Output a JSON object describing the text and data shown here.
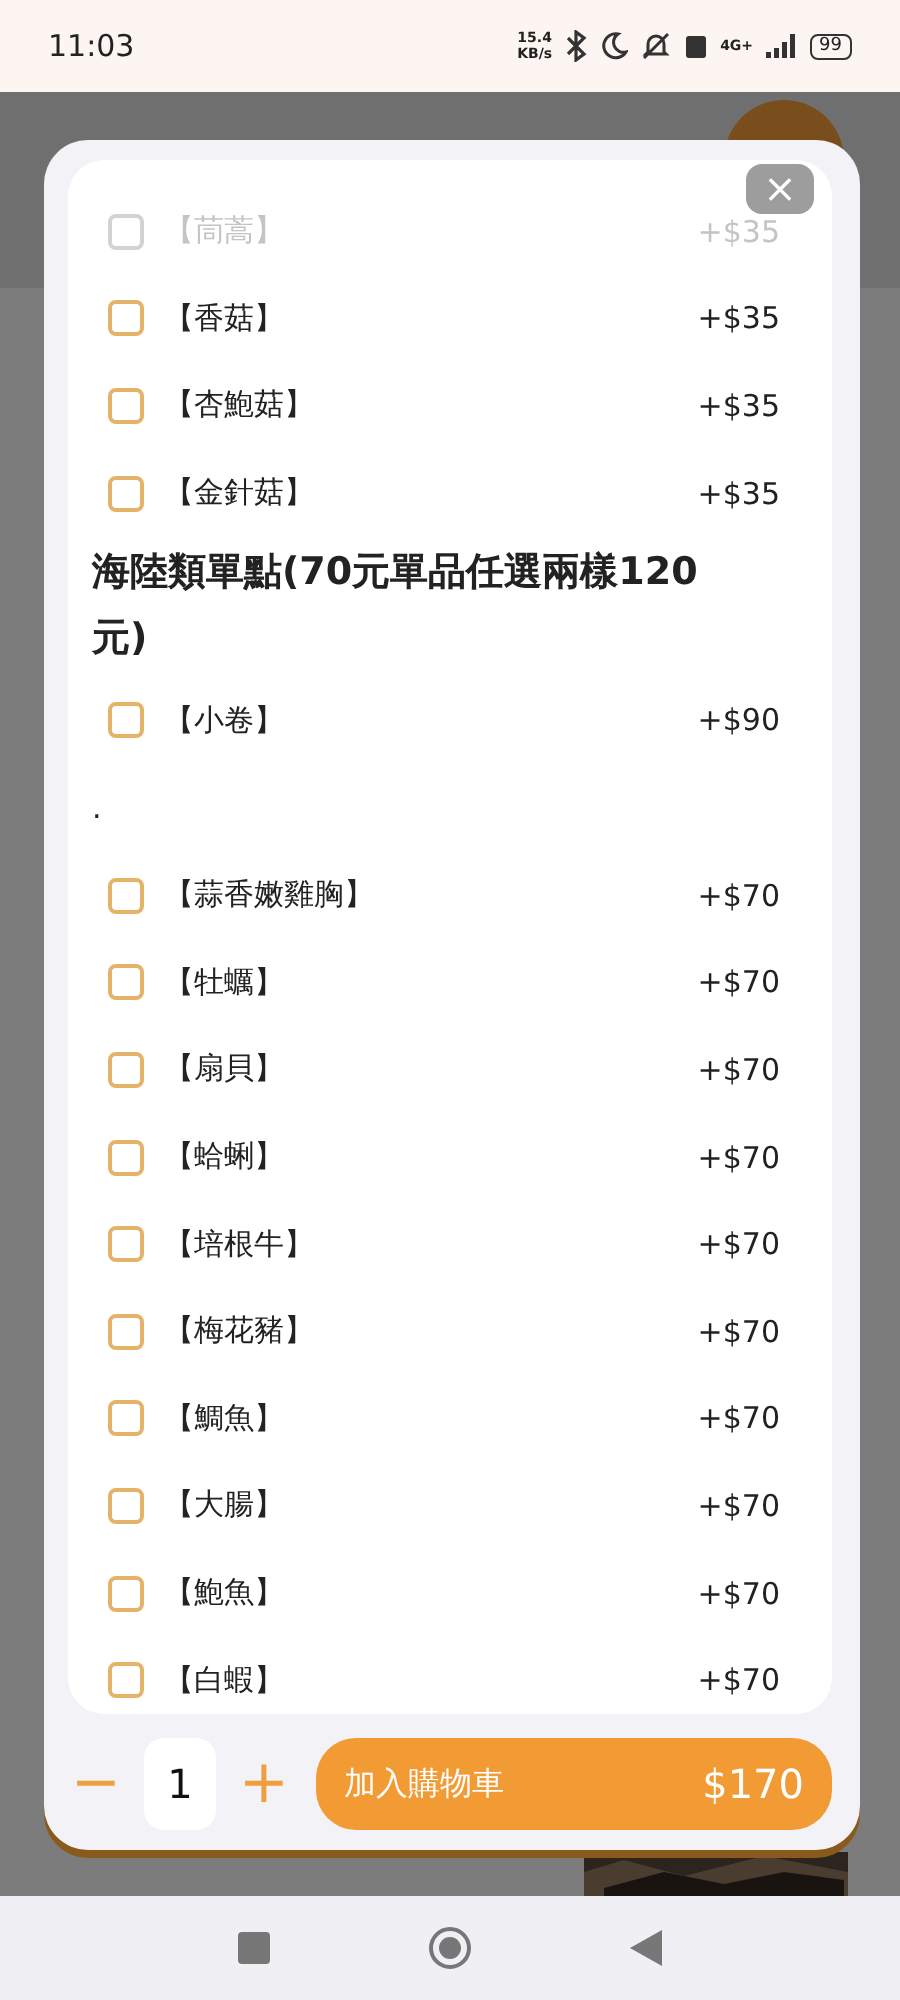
{
  "status_bar": {
    "time": "11:03",
    "speed": "15.4",
    "speed_unit": "KB/s",
    "network": "4G+",
    "battery": "99"
  },
  "options": [
    {
      "kind": "option",
      "label": "【茼蒿】",
      "price": "+$35",
      "checked": false,
      "disabled": true
    },
    {
      "kind": "option",
      "label": "【香菇】",
      "price": "+$35",
      "checked": false,
      "disabled": false
    },
    {
      "kind": "option",
      "label": "【杏鮑菇】",
      "price": "+$35",
      "checked": false,
      "disabled": false
    },
    {
      "kind": "option",
      "label": "【金針菇】",
      "price": "+$35",
      "checked": false,
      "disabled": false
    },
    {
      "kind": "heading",
      "label": "海陸類單點(70元單品任選兩樣120元)"
    },
    {
      "kind": "option",
      "label": "【小卷】",
      "price": "+$90",
      "checked": false,
      "disabled": false
    },
    {
      "kind": "note",
      "label": "."
    },
    {
      "kind": "option",
      "label": "【蒜香嫩雞胸】",
      "price": "+$70",
      "checked": false,
      "disabled": false
    },
    {
      "kind": "option",
      "label": "【牡蠣】",
      "price": "+$70",
      "checked": false,
      "disabled": false
    },
    {
      "kind": "option",
      "label": "【扇貝】",
      "price": "+$70",
      "checked": false,
      "disabled": false
    },
    {
      "kind": "option",
      "label": "【蛤蜊】",
      "price": "+$70",
      "checked": false,
      "disabled": false
    },
    {
      "kind": "option",
      "label": "【培根牛】",
      "price": "+$70",
      "checked": false,
      "disabled": false
    },
    {
      "kind": "option",
      "label": "【梅花豬】",
      "price": "+$70",
      "checked": false,
      "disabled": false
    },
    {
      "kind": "option",
      "label": "【鯛魚】",
      "price": "+$70",
      "checked": false,
      "disabled": false
    },
    {
      "kind": "option",
      "label": "【大腸】",
      "price": "+$70",
      "checked": false,
      "disabled": false
    },
    {
      "kind": "option",
      "label": "【鮑魚】",
      "price": "+$70",
      "checked": false,
      "disabled": false
    },
    {
      "kind": "option",
      "label": "【白蝦】",
      "price": "+$70",
      "checked": false,
      "disabled": false
    }
  ],
  "close_button": "×",
  "quantity": {
    "minus": "−",
    "value": "1",
    "plus": "+"
  },
  "add_to_cart": {
    "label": "加入購物車",
    "total": "$170"
  }
}
